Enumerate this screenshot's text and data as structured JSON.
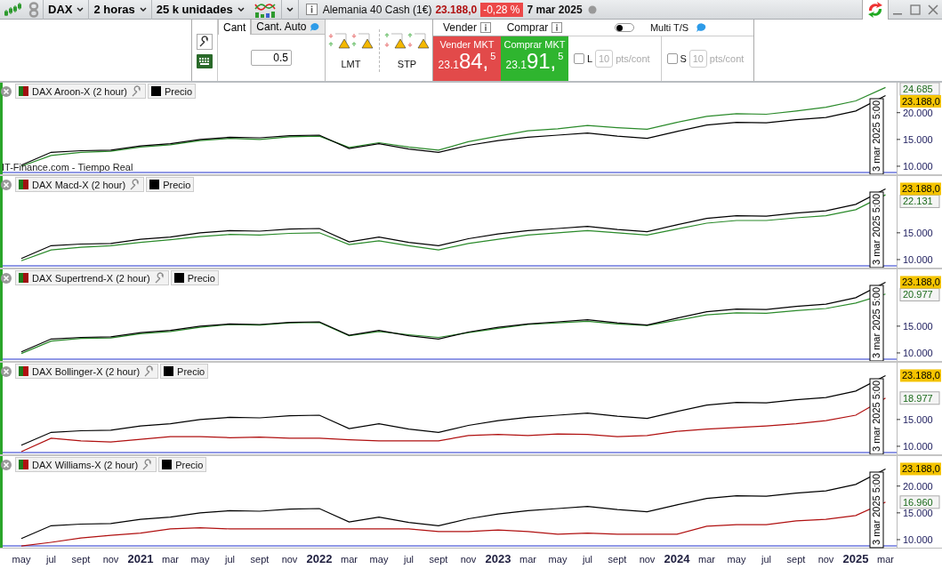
{
  "toolbar": {
    "symbol": "DAX",
    "timeframe": "2 horas",
    "units": "25 k unidades",
    "instrument": "Alemania 40 Cash (1€)",
    "price": "23.188,0",
    "change": "-0,28 %",
    "date": "7 mar 2025"
  },
  "order_panel": {
    "tabs": [
      {
        "label": "Cant",
        "selected": true
      },
      {
        "label": "Cant. Auto",
        "selected": false
      }
    ],
    "quantity": "0.5",
    "limit_label": "LMT",
    "stop_label": "STP",
    "sell": {
      "header": "Vender",
      "label": "Vender MKT",
      "prefix": "23.1",
      "big": "84,",
      "pip": "5"
    },
    "buy": {
      "header": "Comprar",
      "label": "Comprar MKT",
      "prefix": "23.1",
      "big": "91,",
      "pip": "5"
    },
    "multi": {
      "label": "Multi T/S",
      "on": false
    },
    "stops": [
      {
        "label": "L",
        "checked": false,
        "value": "10",
        "unit": "pts/cont"
      },
      {
        "label": "S",
        "checked": false,
        "value": "10",
        "unit": "pts/cont"
      }
    ]
  },
  "source_label": "IT-Finance.com - Tiempo Real",
  "panels": [
    {
      "cursor_label": "3 mar 2025 5:00",
      "last_price": "23.188,0",
      "strategy_value": "24.685",
      "chart_data": {
        "type": "line",
        "ylim": [
          8500,
          25600
        ],
        "yticks": [
          {
            "value": 10000,
            "label": "10.000"
          },
          {
            "value": 15000,
            "label": "15.000"
          },
          {
            "value": 20000,
            "label": "20.000"
          }
        ],
        "series": [
          {
            "name": "DAX Aroon-X (2 hour)",
            "color": "#2a8a2a",
            "values": [
              10000,
              12000,
              12600,
              12800,
              13600,
              14000,
              14800,
              15200,
              15000,
              15500,
              15600,
              13500,
              14400,
              13600,
              13000,
              14600,
              15600,
              16600,
              17000,
              17600,
              17200,
              16900,
              18200,
              19300,
              19800,
              19700,
              20300,
              21000,
              22200,
              24700
            ]
          },
          {
            "name": "Precio",
            "color": "#000000",
            "values": [
              10200,
              12600,
              12900,
              13000,
              13800,
              14200,
              15000,
              15400,
              15300,
              15700,
              15800,
              13300,
              14200,
              13200,
              12600,
              13900,
              14800,
              15400,
              15800,
              16200,
              15600,
              15200,
              16500,
              17700,
              18200,
              18100,
              18700,
              19100,
              20300,
              23200
            ]
          }
        ]
      }
    },
    {
      "cursor_label": "3 mar 2025 5:00",
      "last_price": "23.188,0",
      "strategy_value": "22.131",
      "chart_data": {
        "type": "line",
        "ylim": [
          8500,
          25600
        ],
        "yticks": [
          {
            "value": 10000,
            "label": "10.000"
          },
          {
            "value": 15000,
            "label": "15.000"
          }
        ],
        "series": [
          {
            "name": "DAX Macd-X (2 hour)",
            "color": "#2a8a2a",
            "values": [
              9800,
              11800,
              12300,
              12600,
              13200,
              13700,
              14300,
              14700,
              14600,
              14900,
              15000,
              12800,
              13500,
              12600,
              11800,
              13000,
              13800,
              14600,
              15000,
              15400,
              15000,
              14600,
              15700,
              16800,
              17300,
              17300,
              17800,
              18200,
              19300,
              22100
            ]
          },
          {
            "name": "Precio",
            "color": "#000000",
            "values": [
              10200,
              12600,
              12900,
              13000,
              13800,
              14200,
              15000,
              15400,
              15300,
              15700,
              15800,
              13300,
              14200,
              13200,
              12600,
              13900,
              14800,
              15400,
              15800,
              16200,
              15600,
              15200,
              16500,
              17700,
              18200,
              18100,
              18700,
              19100,
              20300,
              23200
            ]
          }
        ]
      }
    },
    {
      "cursor_label": "3 mar 2025 5:00",
      "last_price": "23.188,0",
      "strategy_value": "20.977",
      "chart_data": {
        "type": "line",
        "ylim": [
          8500,
          25600
        ],
        "yticks": [
          {
            "value": 10000,
            "label": "10.000"
          },
          {
            "value": 15000,
            "label": "15.000"
          }
        ],
        "series": [
          {
            "name": "DAX Supertrend-X (2 hour)",
            "color": "#2a8a2a",
            "values": [
              9900,
              12200,
              12700,
              12800,
              13600,
              14000,
              14800,
              15300,
              15200,
              15600,
              15700,
              13200,
              14000,
              13400,
              12900,
              13800,
              14600,
              15300,
              15600,
              15900,
              15400,
              15100,
              16100,
              17100,
              17500,
              17400,
              17900,
              18300,
              19300,
              21000
            ]
          },
          {
            "name": "Precio",
            "color": "#000000",
            "values": [
              10200,
              12600,
              12900,
              13000,
              13800,
              14200,
              15000,
              15400,
              15300,
              15700,
              15800,
              13300,
              14200,
              13200,
              12600,
              13900,
              14800,
              15400,
              15800,
              16200,
              15600,
              15200,
              16500,
              17700,
              18200,
              18100,
              18700,
              19100,
              20300,
              23200
            ]
          }
        ]
      }
    },
    {
      "cursor_label": "3 mar 2025 5:00",
      "last_price": "23.188,0",
      "strategy_value": "18.977",
      "chart_data": {
        "type": "line",
        "ylim": [
          8500,
          25600
        ],
        "yticks": [
          {
            "value": 10000,
            "label": "10.000"
          },
          {
            "value": 15000,
            "label": "15.000"
          }
        ],
        "series": [
          {
            "name": "DAX Bollinger-X (2 hour)",
            "color": "#b01010",
            "values": [
              9000,
              11500,
              11000,
              10800,
              11300,
              11800,
              11800,
              11600,
              11700,
              11500,
              11500,
              11200,
              11000,
              11000,
              11000,
              12000,
              12200,
              12000,
              12300,
              12200,
              11800,
              12000,
              12800,
              13200,
              13500,
              13800,
              14200,
              14800,
              15800,
              19000
            ]
          },
          {
            "name": "Precio",
            "color": "#000000",
            "values": [
              10200,
              12600,
              12900,
              13000,
              13800,
              14200,
              15000,
              15400,
              15300,
              15700,
              15800,
              13300,
              14200,
              13200,
              12600,
              13900,
              14800,
              15400,
              15800,
              16200,
              15600,
              15200,
              16500,
              17700,
              18200,
              18100,
              18700,
              19100,
              20300,
              23200
            ]
          }
        ]
      }
    },
    {
      "cursor_label": "3 mar 2025 5:00",
      "last_price": "23.188,0",
      "strategy_value": "16.960",
      "chart_data": {
        "type": "line",
        "ylim": [
          8500,
          25600
        ],
        "yticks": [
          {
            "value": 10000,
            "label": "10.000"
          },
          {
            "value": 15000,
            "label": "15.000"
          },
          {
            "value": 20000,
            "label": "20.000"
          }
        ],
        "categories": [
          "may",
          "jul",
          "sept",
          "nov",
          "2021",
          "mar",
          "may",
          "jul",
          "sept",
          "nov",
          "2022",
          "mar",
          "may",
          "jul",
          "sept",
          "nov",
          "2023",
          "mar",
          "may",
          "jul",
          "sept",
          "nov",
          "2024",
          "mar",
          "may",
          "jul",
          "sept",
          "nov",
          "2025",
          "mar"
        ],
        "series": [
          {
            "name": "DAX Williams-X (2 hour)",
            "color": "#b01010",
            "values": [
              8800,
              9500,
              10300,
              10800,
              11200,
              12000,
              12200,
              12000,
              12000,
              12000,
              12000,
              12000,
              12000,
              12000,
              11500,
              11500,
              11800,
              11500,
              11000,
              11200,
              11000,
              11000,
              11000,
              12500,
              12800,
              12800,
              13500,
              13800,
              14500,
              17000
            ]
          },
          {
            "name": "Precio",
            "color": "#000000",
            "values": [
              10200,
              12600,
              12900,
              13000,
              13800,
              14200,
              15000,
              15400,
              15300,
              15700,
              15800,
              13300,
              14200,
              13200,
              12600,
              13900,
              14800,
              15400,
              15800,
              16200,
              15600,
              15200,
              16500,
              17700,
              18200,
              18100,
              18700,
              19100,
              20300,
              23200
            ]
          }
        ]
      }
    }
  ]
}
